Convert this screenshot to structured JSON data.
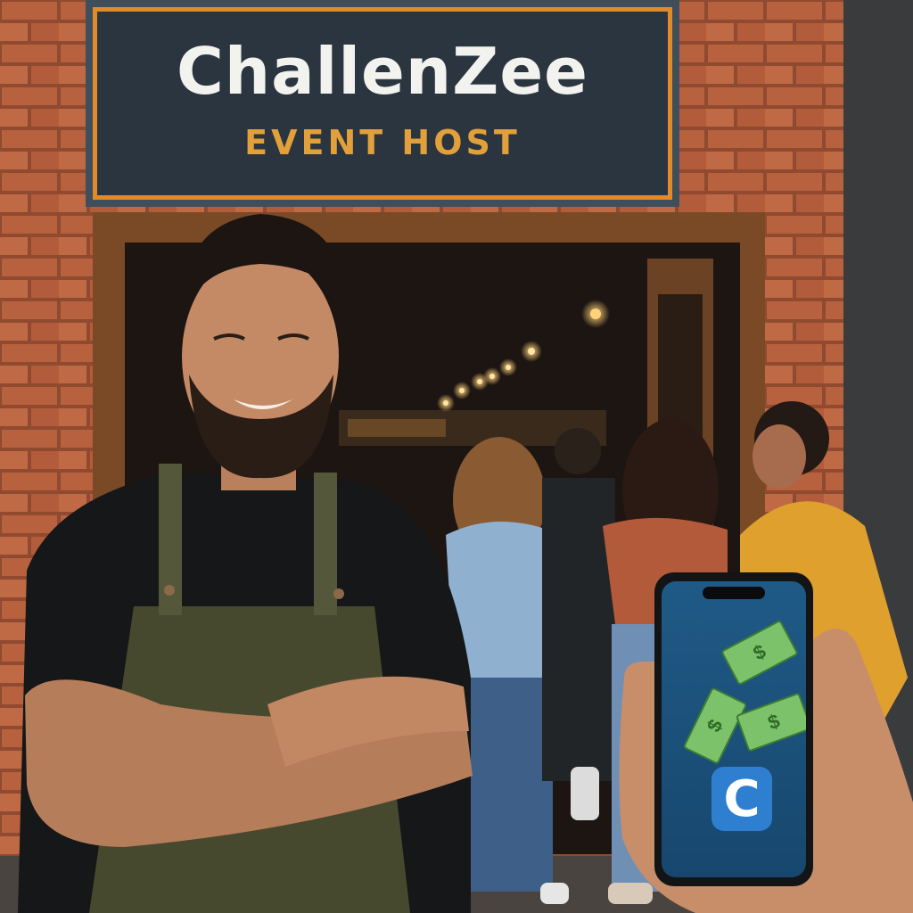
{
  "sign": {
    "title": "ChallenZee",
    "subtitle": "EVENT HOST"
  },
  "phone": {
    "bills": [
      "$",
      "$",
      "$"
    ],
    "app_icon_letter": "C"
  },
  "colors": {
    "brick": "#b8613f",
    "sign_board": "#2b3540",
    "sign_border": "#e08a2a",
    "sign_subtitle": "#e1a03a",
    "phone_screen": "#1f5a86",
    "app_icon": "#2f7fd0",
    "bill": "#7cc26a"
  }
}
